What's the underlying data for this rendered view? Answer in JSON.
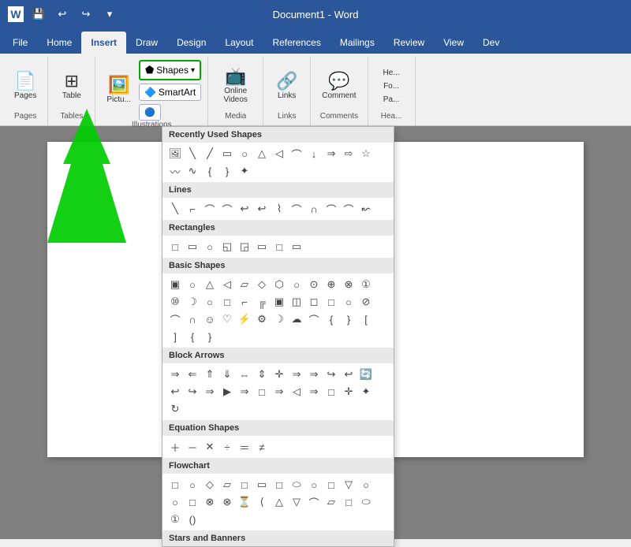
{
  "titleBar": {
    "title": "Document1 - Word",
    "appWord": "Word",
    "docName": "Document1"
  },
  "tabs": [
    {
      "label": "File",
      "active": false
    },
    {
      "label": "Home",
      "active": false
    },
    {
      "label": "Insert",
      "active": true
    },
    {
      "label": "Draw",
      "active": false
    },
    {
      "label": "Design",
      "active": false
    },
    {
      "label": "Layout",
      "active": false
    },
    {
      "label": "References",
      "active": false
    },
    {
      "label": "Mailings",
      "active": false
    },
    {
      "label": "Review",
      "active": false
    },
    {
      "label": "View",
      "active": false
    },
    {
      "label": "Dev",
      "active": false
    }
  ],
  "ribbon": {
    "groups": [
      {
        "label": "Pages",
        "id": "pages"
      },
      {
        "label": "Tables",
        "id": "tables"
      },
      {
        "label": "Illustrations",
        "id": "illustrations"
      },
      {
        "label": "Media",
        "id": "media"
      },
      {
        "label": "Links",
        "id": "links"
      },
      {
        "label": "Comments",
        "id": "comments"
      },
      {
        "label": "Headers",
        "id": "headers"
      }
    ]
  },
  "shapesDropdown": {
    "sections": [
      {
        "header": "Recently Used Shapes",
        "shapes": [
          "▭",
          "╲",
          "╱",
          "□",
          "○",
          "△",
          "▷",
          "⌇",
          "↓",
          "⇒",
          "⇨",
          "☆",
          "♾",
          "⌒",
          "❴",
          "❵",
          "✦"
        ]
      },
      {
        "header": "Lines",
        "shapes": [
          "╲",
          "⌒",
          "⌒",
          "⌒",
          "↩",
          "↩",
          "⌇",
          "⌒",
          "∩",
          "⌒",
          "⌒",
          "↜"
        ]
      },
      {
        "header": "Rectangles",
        "shapes": [
          "□",
          "□",
          "○",
          "□",
          "□",
          "□",
          "□",
          "□"
        ]
      },
      {
        "header": "Basic Shapes",
        "shapes": [
          "▣",
          "○",
          "△",
          "◁",
          "▱",
          "◇",
          "⬡",
          "○",
          "○",
          "⊕",
          "⊗",
          "①",
          "①",
          "☽",
          "○",
          "□",
          "⌐",
          "╔",
          "🔲",
          "🔲",
          "🔳",
          "□",
          "○",
          "⊘",
          "⌒",
          "∩",
          "☺",
          "♡",
          "✿",
          "⚙",
          "☽",
          "☁",
          "⌒",
          "❴",
          "❵",
          "❴",
          "❵",
          "❬",
          "❭",
          "❴",
          "❵"
        ]
      },
      {
        "header": "Block Arrows",
        "shapes": [
          "⇒",
          "⇐",
          "⇑",
          "⇓",
          "⇔",
          "⇕",
          "✛",
          "⇒",
          "⇒",
          "↪",
          "↩",
          "🔄",
          "↩",
          "↪",
          "⇒",
          "▷",
          "⇒",
          "□",
          "⇒",
          "□",
          "⇒",
          "□",
          "✛",
          "✦",
          "↻"
        ]
      },
      {
        "header": "Equation Shapes",
        "shapes": [
          "＋",
          "－",
          "✕",
          "÷",
          "＝",
          "≠"
        ]
      },
      {
        "header": "Flowchart",
        "shapes": [
          "□",
          "○",
          "◇",
          "▱",
          "□",
          "□",
          "□",
          "⬭",
          "○",
          "□",
          "▽",
          "○",
          "○",
          "□",
          "⊗",
          "⊗",
          "⏳",
          "⟨",
          "△",
          "▽",
          "⌒",
          "▱",
          "□",
          "⬭",
          "①",
          "()"
        ]
      },
      {
        "header": "Stars and Banners",
        "shapes": []
      }
    ]
  },
  "arrow": {
    "visible": true
  },
  "buttons": {
    "pages": "Pages",
    "table": "Table",
    "pictures": "Pictu...",
    "shapes": "Shapes",
    "shapesDropdown": "▾",
    "smartArt": "SmartArt",
    "onlineVideos": "Online Videos",
    "links": "Links",
    "comment": "Comment",
    "headers": "He...",
    "fo": "Fo...",
    "pa": "Pa..."
  }
}
